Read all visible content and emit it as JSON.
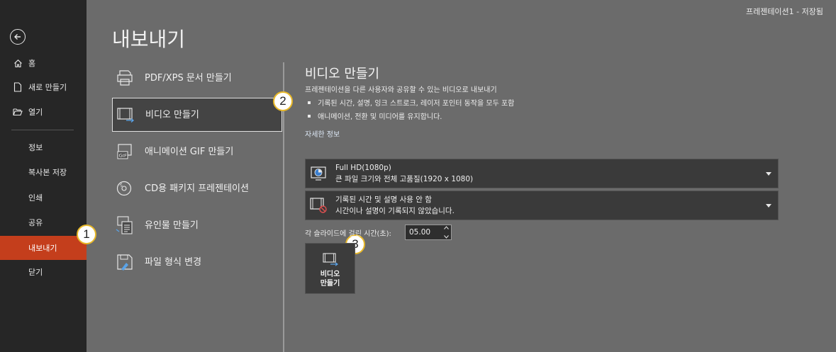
{
  "window": {
    "doc_status": "프레젠테이션1  -  저장됨"
  },
  "nav": {
    "items": [
      {
        "label": "홈",
        "icon": "home-icon"
      },
      {
        "label": "새로 만들기",
        "icon": "new-document-icon"
      },
      {
        "label": "열기",
        "icon": "folder-open-icon"
      },
      {
        "label": "정보"
      },
      {
        "label": "복사본 저장"
      },
      {
        "label": "인쇄"
      },
      {
        "label": "공유"
      },
      {
        "label": "내보내기",
        "active": true
      },
      {
        "label": "닫기"
      }
    ]
  },
  "page": {
    "title": "내보내기"
  },
  "export_options": [
    {
      "label": "PDF/XPS 문서 만들기",
      "icon": "pdf-printer-icon"
    },
    {
      "label": "비디오 만들기",
      "icon": "video-film-icon",
      "selected": true
    },
    {
      "label": "애니메이션 GIF 만들기",
      "icon": "gif-icon"
    },
    {
      "label": "CD용 패키지 프레젠테이션",
      "icon": "cd-package-icon"
    },
    {
      "label": "유인물 만들기",
      "icon": "handout-icon"
    },
    {
      "label": "파일 형식 변경",
      "icon": "file-type-icon"
    }
  ],
  "callouts": [
    "1",
    "2",
    "3"
  ],
  "video": {
    "title": "비디오 만들기",
    "description": "프레젠테이션을 다른 사용자와 공유할 수 있는 비디오로 내보내기",
    "bullets": [
      "기록된 시간, 설명, 잉크 스트로크, 레이저 포인터 동작을 모두 포함",
      "애니메이션, 전환 및 미디어를 유지합니다."
    ],
    "more_info_link": "자세한 정보",
    "quality": {
      "title": "Full HD(1080p)",
      "subtitle": "큰 파일 크기와 전체 고품질(1920 x 1080)"
    },
    "narration": {
      "title": "기록된 시간 및 설명 사용 안 함",
      "subtitle": "시간이나 설명이 기록되지 않았습니다."
    },
    "duration_label": "각 슬라이드에 걸린 시간(초):",
    "duration_value": "05.00",
    "create_button": {
      "line1": "비디오",
      "line2": "만들기"
    }
  },
  "colors": {
    "accent": "#c43e1c",
    "nav_bg": "#262626",
    "main_bg": "#6b6b6b",
    "callout_border": "#e8b828"
  }
}
